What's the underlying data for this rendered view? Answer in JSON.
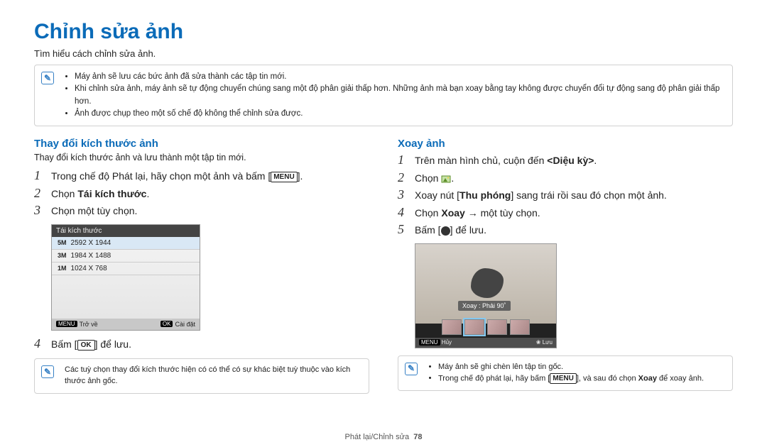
{
  "title": "Chỉnh sửa ảnh",
  "intro": "Tìm hiểu cách chỉnh sửa ảnh.",
  "top_notes": [
    "Máy ảnh sẽ lưu các bức ảnh đã sửa thành các tập tin mới.",
    "Khi chỉnh sửa ảnh, máy ảnh sẽ tự động chuyển chúng sang một độ phân giải thấp hơn. Những ảnh mà bạn xoay bằng tay không được chuyển đổi tự động sang độ phân giải thấp hơn.",
    "Ảnh được chụp theo một số chế độ không thể chỉnh sửa được."
  ],
  "left": {
    "heading": "Thay đổi kích thước ảnh",
    "sub": "Thay đổi kích thước ảnh và lưu thành một tập tin mới.",
    "step1_pre": "Trong chế độ Phát lại, hãy chọn một ảnh và bấm [",
    "step1_btn": "MENU",
    "step1_post": "].",
    "step2_pre": "Chọn ",
    "step2_bold": "Tái kích thước",
    "step2_post": ".",
    "step3": "Chọn một tùy chọn.",
    "panel_title": "Tái kích thước",
    "opts": [
      {
        "tag": "5M",
        "dim": "2592 X 1944"
      },
      {
        "tag": "3M",
        "dim": "1984 X 1488"
      },
      {
        "tag": "1M",
        "dim": "1024 X 768"
      }
    ],
    "panel_back": "Trở về",
    "panel_set": "Cài đặt",
    "step4_pre": "Bấm [",
    "step4_btn": "OK",
    "step4_post": "] để lưu.",
    "note": "Các tuỳ chọn thay đổi kích thước hiện có có thể có sự khác biệt tuỳ thuộc vào kích thước ảnh gốc."
  },
  "right": {
    "heading": "Xoay ảnh",
    "step1_pre": "Trên màn hình chủ, cuộn đến ",
    "step1_bold": "<Diệu kỳ>",
    "step1_post": ".",
    "step2": "Chọn ",
    "step3_pre": "Xoay nút [",
    "step3_bold": "Thu phóng",
    "step3_post": "] sang trái rồi sau đó chọn một ảnh.",
    "step4_pre": "Chọn ",
    "step4_bold": "Xoay",
    "step4_post": " → một tùy chọn.",
    "step5_pre": "Bấm [",
    "step5_post": "] để lưu.",
    "tooltip": "Xoay : Phải 90˚",
    "panel_cancel": "Hủy",
    "panel_save": "Lưu",
    "notes": [
      "Máy ảnh sẽ ghi chèn lên tập tin gốc."
    ],
    "note2_pre": "Trong chế độ phát lại, hãy bấm [",
    "note2_btn": "MENU",
    "note2_mid": "], và sau đó chọn ",
    "note2_bold": "Xoay",
    "note2_post": " để xoay ảnh."
  },
  "footer_section": "Phát lại/Chỉnh sửa",
  "footer_page": "78"
}
